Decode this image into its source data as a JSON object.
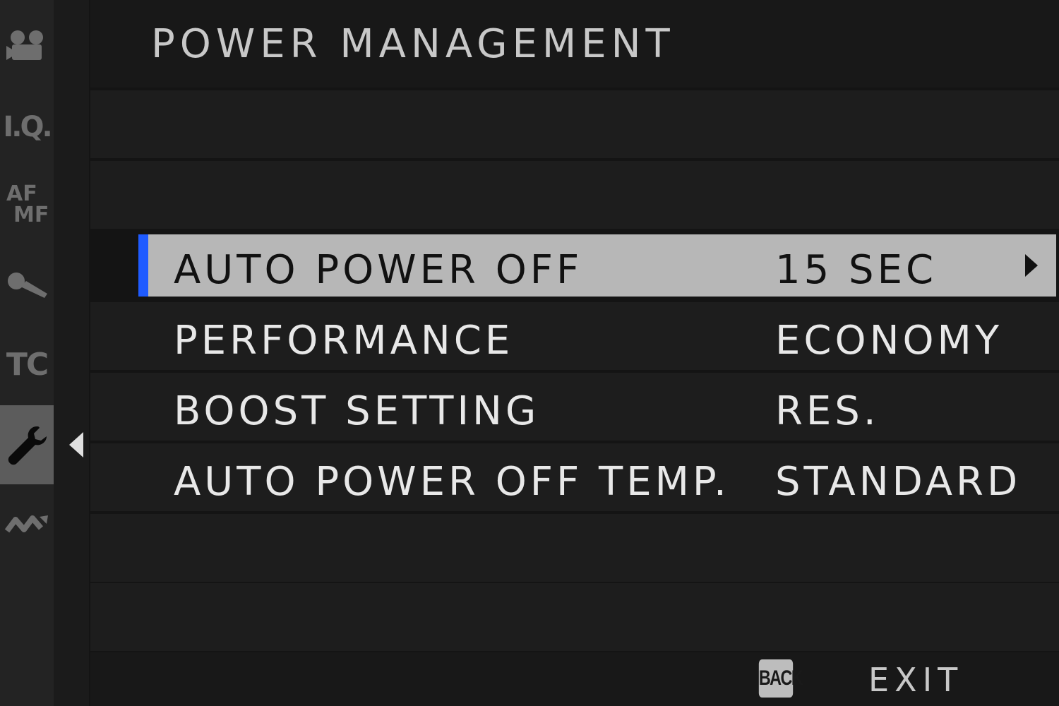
{
  "header": {
    "title": "POWER MANAGEMENT"
  },
  "rail": {
    "items": [
      {
        "icon": "movie-camera-icon"
      },
      {
        "icon": "iq-icon",
        "text": "I.Q."
      },
      {
        "icon": "af-mf-icon",
        "text_top": "AF",
        "text_bottom": "MF"
      },
      {
        "icon": "microphone-icon"
      },
      {
        "icon": "tc-icon",
        "text": "TC"
      },
      {
        "icon": "wrench-icon",
        "active": true
      },
      {
        "icon": "connection-icon"
      }
    ]
  },
  "menu": {
    "items": [
      {
        "label": "AUTO POWER OFF",
        "value": "15 SEC",
        "selected": true
      },
      {
        "label": "PERFORMANCE",
        "value": "ECONOMY"
      },
      {
        "label": "BOOST SETTING",
        "value": "RES."
      },
      {
        "label": "AUTO POWER OFF TEMP.",
        "value": "STANDARD"
      }
    ]
  },
  "footer": {
    "back_label": "BACK",
    "exit_label": "EXIT"
  },
  "colors": {
    "selection_marker": "#1f5bff",
    "selected_row": "#b7b7b7",
    "background": "#141414"
  }
}
